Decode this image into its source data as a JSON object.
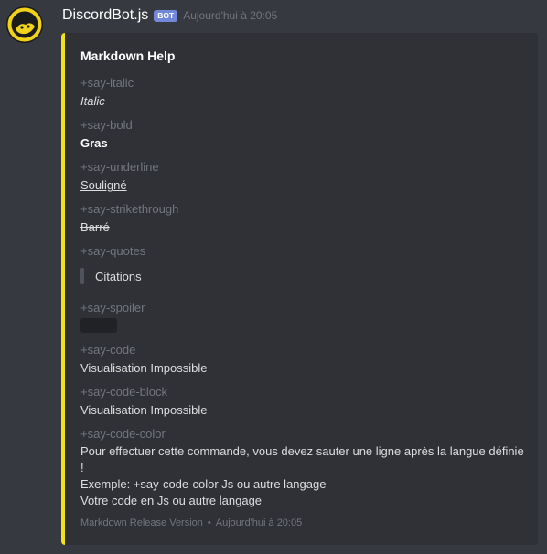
{
  "message": {
    "username": "DiscordBot.js",
    "bot_tag": "BOT",
    "timestamp": "Aujourd'hui à 20:05"
  },
  "embed": {
    "accent_color": "#f0e31a",
    "title": "Markdown Help",
    "fields": {
      "italic": {
        "name": "+say-italic",
        "value": "Italic"
      },
      "bold": {
        "name": "+say-bold",
        "value": "Gras"
      },
      "underline": {
        "name": "+say-underline",
        "value": "Souligné"
      },
      "strikethrough": {
        "name": "+say-strikethrough",
        "value": "Barré"
      },
      "quotes": {
        "name": "+say-quotes",
        "value": "Citations"
      },
      "spoiler": {
        "name": "+say-spoiler"
      },
      "code": {
        "name": "+say-code",
        "value": "Visualisation Impossible"
      },
      "code_block": {
        "name": "+say-code-block",
        "value": "Visualisation Impossible"
      },
      "code_color": {
        "name": "+say-code-color",
        "lines": [
          "Pour effectuer cette commande, vous devez sauter une ligne après la langue définie",
          "!",
          "Exemple: +say-code-color Js ou autre langage",
          "Votre code en Js ou autre langage"
        ]
      }
    },
    "footer": {
      "text": "Markdown Release Version",
      "separator": "•",
      "timestamp": "Aujourd'hui à 20:05"
    }
  }
}
